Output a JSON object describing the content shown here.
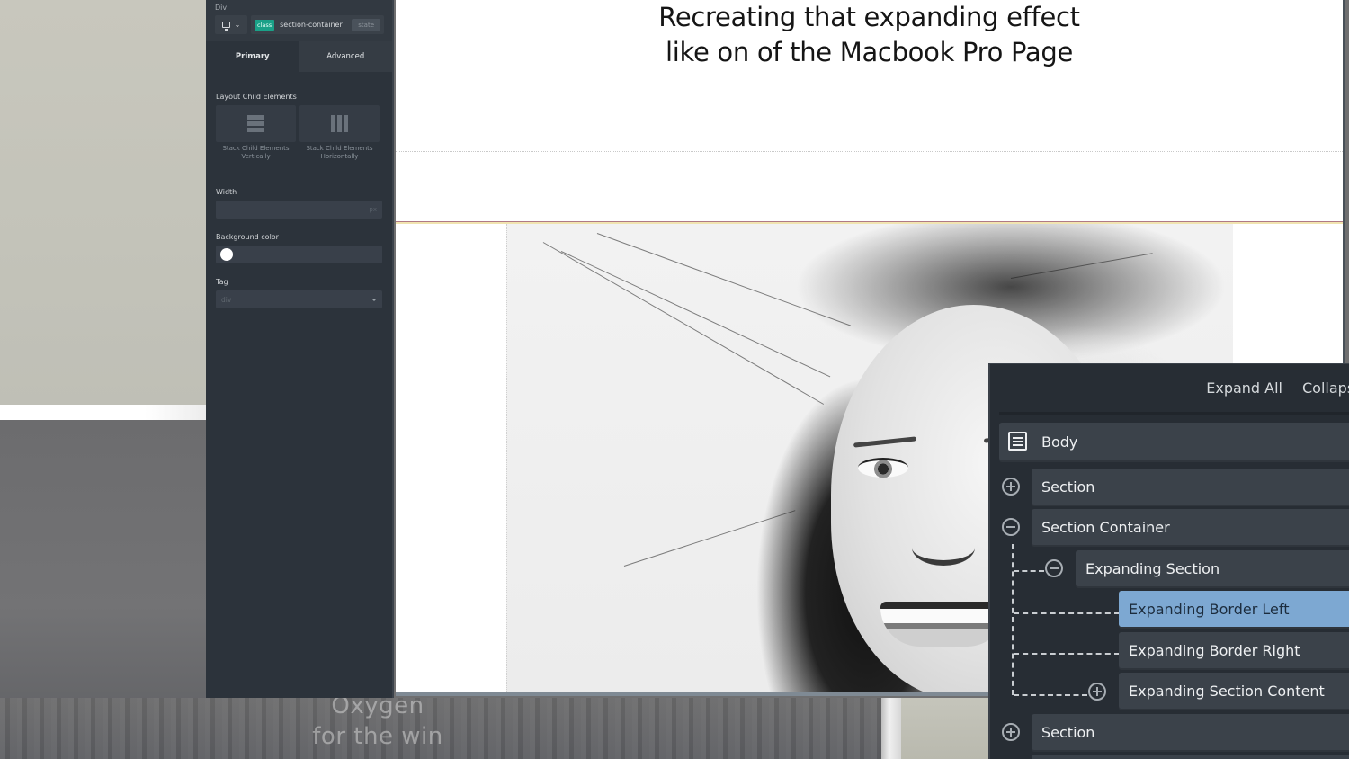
{
  "background": {
    "overlay_text": [
      "Oxygen",
      "for the win"
    ]
  },
  "properties_panel": {
    "element_type": "Div",
    "device_icon": "monitor-icon",
    "class_badge": "class",
    "class_name": "section-container",
    "state_button": "state",
    "tabs": [
      {
        "label": "Primary",
        "active": true
      },
      {
        "label": "Advanced",
        "active": false
      }
    ],
    "layout_section_label": "Layout Child Elements",
    "layout_options": [
      {
        "caption_line1": "Stack Child Elements",
        "caption_line2": "Vertically",
        "icon": "stack-vertical-icon"
      },
      {
        "caption_line1": "Stack Child Elements",
        "caption_line2": "Horizontally",
        "icon": "stack-horizontal-icon"
      }
    ],
    "width": {
      "label": "Width",
      "value": "",
      "unit": "px"
    },
    "background_color": {
      "label": "Background color",
      "value": "#ffffff"
    },
    "tag": {
      "label": "Tag",
      "value": "div"
    }
  },
  "canvas": {
    "title_line1": "Recreating that expanding effect",
    "title_line2": "like on of the Macbook Pro Page",
    "image_alt": "black-and-white portrait of a woman"
  },
  "structure_panel": {
    "expand_all": "Expand All",
    "collapse_all": "Collapse All",
    "nodes": [
      {
        "label": "Body",
        "level": 0,
        "toggle": "none",
        "selected": false
      },
      {
        "label": "Section",
        "level": 1,
        "toggle": "expand",
        "selected": false
      },
      {
        "label": "Section Container",
        "level": 1,
        "toggle": "collapse",
        "selected": false
      },
      {
        "label": "Expanding Section",
        "level": 2,
        "toggle": "collapse",
        "selected": false
      },
      {
        "label": "Expanding Border Left",
        "level": 3,
        "toggle": "none",
        "selected": true
      },
      {
        "label": "Expanding Border Right",
        "level": 3,
        "toggle": "none",
        "selected": false
      },
      {
        "label": "Expanding Section Content",
        "level": 3,
        "toggle": "expand",
        "selected": false
      },
      {
        "label": "Section",
        "level": 1,
        "toggle": "expand",
        "selected": false
      }
    ],
    "selected_color": "#7da8d2"
  }
}
